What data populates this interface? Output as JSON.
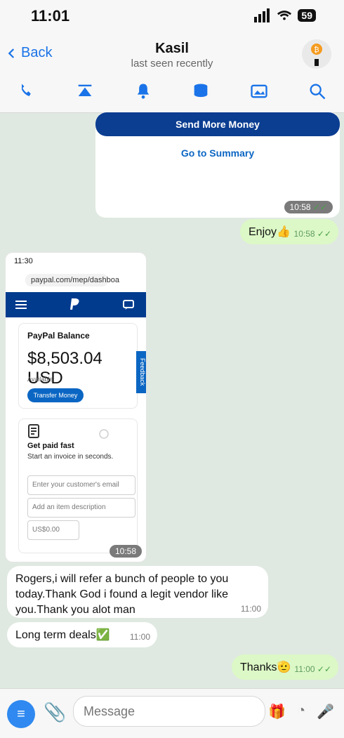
{
  "status": {
    "time": "11:01",
    "battery": "59"
  },
  "header": {
    "back_label": "Back",
    "title": "Kasil",
    "subtitle": "last seen recently"
  },
  "actions": [
    "call-icon",
    "call-minimize-icon",
    "bell-icon",
    "stack-icon",
    "image-icon",
    "search-icon"
  ],
  "chat": {
    "card": {
      "send_more": "Send More Money",
      "go_summary": "Go to Summary",
      "time": "10:58"
    },
    "enjoy": {
      "text": "Enjoy👍",
      "time": "10:58"
    },
    "screenshot": {
      "time": "11:30",
      "url": "paypal.com/mep/dashboa",
      "balance_label": "PayPal Balance",
      "amount": "$8,503.04 USD",
      "available": "Available",
      "transfer": "Transfer Money",
      "feedback": "Feedback",
      "paid_label": "Get paid fast",
      "paid_sub": "Start an invoice in seconds.",
      "inputs": [
        "Enter your customer's email",
        "Add an item description",
        "US$0.00"
      ],
      "time_label": "10:58"
    },
    "rogers": {
      "text": "Rogers,i will refer a bunch of people to you today.Thank God i found a legit vendor like you.Thank you alot man",
      "time": "11:00"
    },
    "long_term": {
      "text": "Long term deals✅",
      "time": "11:00"
    },
    "thanks": {
      "text": "Thanks🫡",
      "time": "11:00"
    }
  },
  "composer": {
    "placeholder": "Message"
  }
}
